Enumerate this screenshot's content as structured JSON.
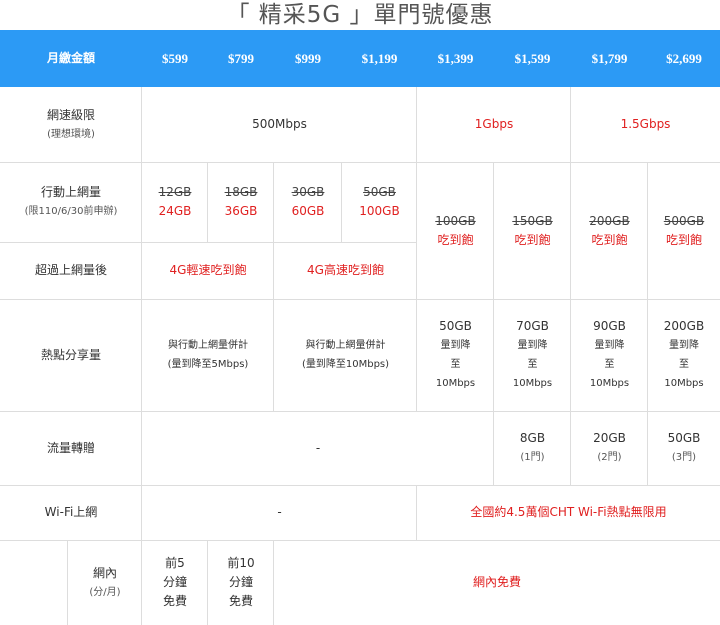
{
  "page": {
    "title": "「 精采5G 」單門號優惠"
  },
  "header": {
    "label": "月繳金額",
    "prices": [
      "$599",
      "$799",
      "$999",
      "$1,199",
      "$1,399",
      "$1,599",
      "$1,799",
      "$2,699"
    ]
  },
  "speed": {
    "label": "網速級限",
    "sublabel": "(理想環境)",
    "values": [
      "500Mbps",
      "1Gbps",
      "1.5Gbps"
    ]
  },
  "mobile_data": {
    "label": "行動上網量",
    "sublabel": "(限110/6/30前申辦)",
    "old": [
      "12GB",
      "18GB",
      "30GB",
      "50GB",
      "100GB",
      "150GB",
      "200GB",
      "500GB"
    ],
    "new": [
      "24GB",
      "36GB",
      "60GB",
      "100GB"
    ],
    "unlimited": "吃到飽"
  },
  "over_quota": {
    "label": "超過上網量後",
    "values": [
      "4G輕速吃到飽",
      "4G高速吃到飽"
    ]
  },
  "hotspot": {
    "label": "熱點分享量",
    "shared_line1": "與行動上網量併計",
    "shared_5": "(量到降至5Mbps)",
    "shared_10": "(量到降至10Mbps)",
    "amounts": [
      "50GB",
      "70GB",
      "90GB",
      "200GB"
    ],
    "line2": "量到降",
    "line3": "至",
    "line4": "10Mbps"
  },
  "transfer": {
    "label": "流量轉贈",
    "dash": "-",
    "amounts": [
      "8GB",
      "20GB",
      "50GB"
    ],
    "lines": [
      "(1門)",
      "(2門)",
      "(3門)"
    ]
  },
  "wifi": {
    "label": "Wi-Fi上網",
    "dash": "-",
    "value": "全國約4.5萬個CHT Wi-Fi熱點無限用"
  },
  "voice": {
    "label": "網內",
    "sublabel": "(分/月)",
    "free5": [
      "前5",
      "分鐘",
      "免費"
    ],
    "free10": [
      "前10",
      "分鐘",
      "免費"
    ],
    "free_all": "網內免費"
  }
}
